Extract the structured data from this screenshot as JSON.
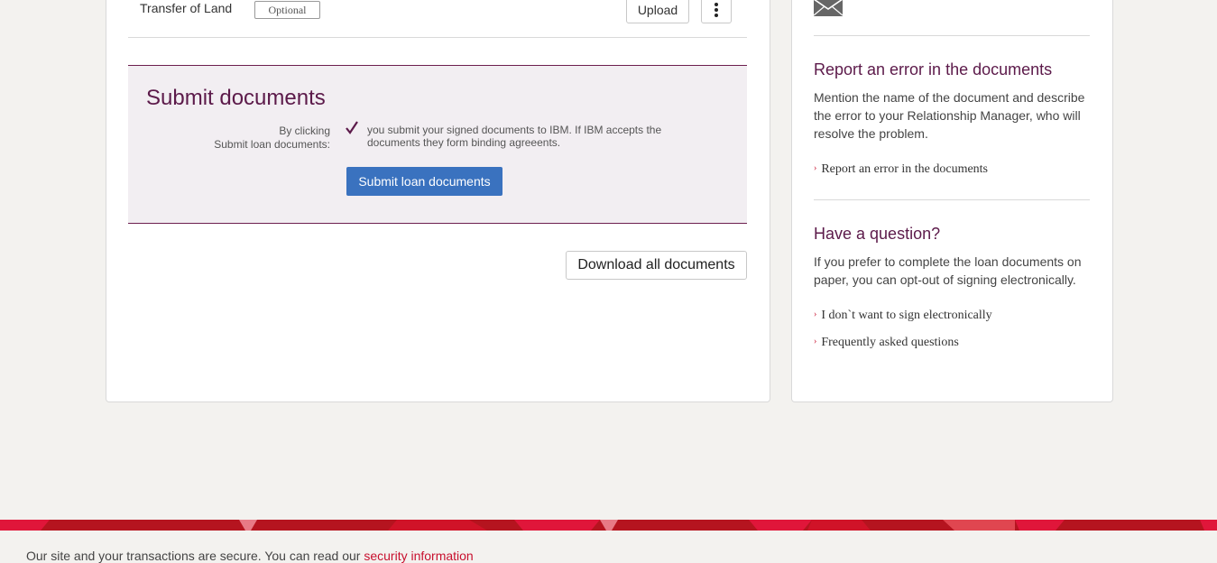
{
  "document_row": {
    "name": "Transfer of Land",
    "badge": "Optional",
    "upload_label": "Upload"
  },
  "submit_panel": {
    "title": "Submit documents",
    "by_clicking_line1": "By clicking",
    "by_clicking_line2": "Submit loan documents:",
    "agreement_text": "you submit your signed documents to IBM. If IBM accepts the documents they form binding agreeents.",
    "submit_label": "Submit loan documents"
  },
  "download_all_label": "Download all documents",
  "sidebar": {
    "report_title": "Report an error in the documents",
    "report_text": "Mention the name of the document and describe the error to your Relationship Manager, who will resolve the problem.",
    "report_link": "Report an error in the documents",
    "question_title": "Have a question?",
    "question_text": "If you prefer to complete the loan documents on paper, you can opt-out of signing electronically.",
    "optout_link": "I don`t want to sign electronically",
    "faq_link": "Frequently asked questions"
  },
  "footer": {
    "text": "Our site and your transactions are secure. You can read our ",
    "link": "security information"
  },
  "colors": {
    "accent_purple": "#5c1a4a",
    "button_blue": "#3a72bf",
    "brand_red": "#c8102e",
    "panel_bg": "#f2eef2"
  }
}
